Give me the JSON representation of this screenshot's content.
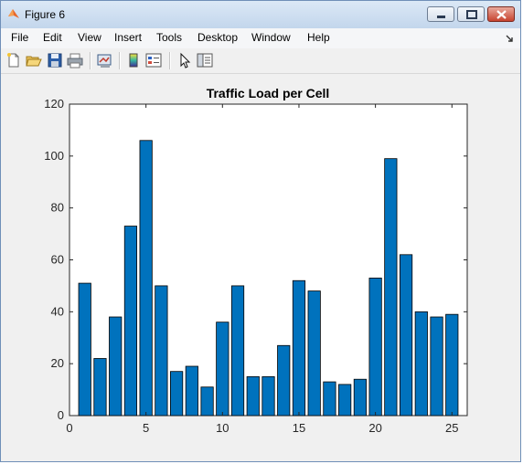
{
  "window": {
    "title": "Figure 6"
  },
  "menu": [
    "File",
    "Edit",
    "View",
    "Insert",
    "Tools",
    "Desktop",
    "Window",
    "Help"
  ],
  "toolbar": {
    "icons": [
      "new-figure-icon",
      "open-file-icon",
      "save-icon",
      "print-icon",
      "link-plot-icon",
      "colorbar-icon",
      "legend-icon",
      "edit-plot-arrow-icon",
      "property-inspector-icon"
    ]
  },
  "colors": {
    "bar_fill": "#0072BD",
    "bar_edge": "#000000",
    "plot_bg": "#ffffff",
    "figure_bg": "#f0f0f0"
  },
  "chart_data": {
    "type": "bar",
    "title": "Traffic Load per Cell",
    "xlabel": "",
    "ylabel": "",
    "x": [
      1,
      2,
      3,
      4,
      5,
      6,
      7,
      8,
      9,
      10,
      11,
      12,
      13,
      14,
      15,
      16,
      17,
      18,
      19,
      20,
      21,
      22,
      23,
      24,
      25
    ],
    "values": [
      51,
      22,
      38,
      73,
      106,
      50,
      17,
      19,
      11,
      36,
      50,
      15,
      15,
      27,
      52,
      48,
      13,
      12,
      14,
      53,
      99,
      62,
      40,
      38,
      39
    ],
    "xlim": [
      0,
      26
    ],
    "ylim": [
      0,
      120
    ],
    "xticks": [
      0,
      5,
      10,
      15,
      20,
      25
    ],
    "yticks": [
      0,
      20,
      40,
      60,
      80,
      100,
      120
    ],
    "grid": false
  }
}
